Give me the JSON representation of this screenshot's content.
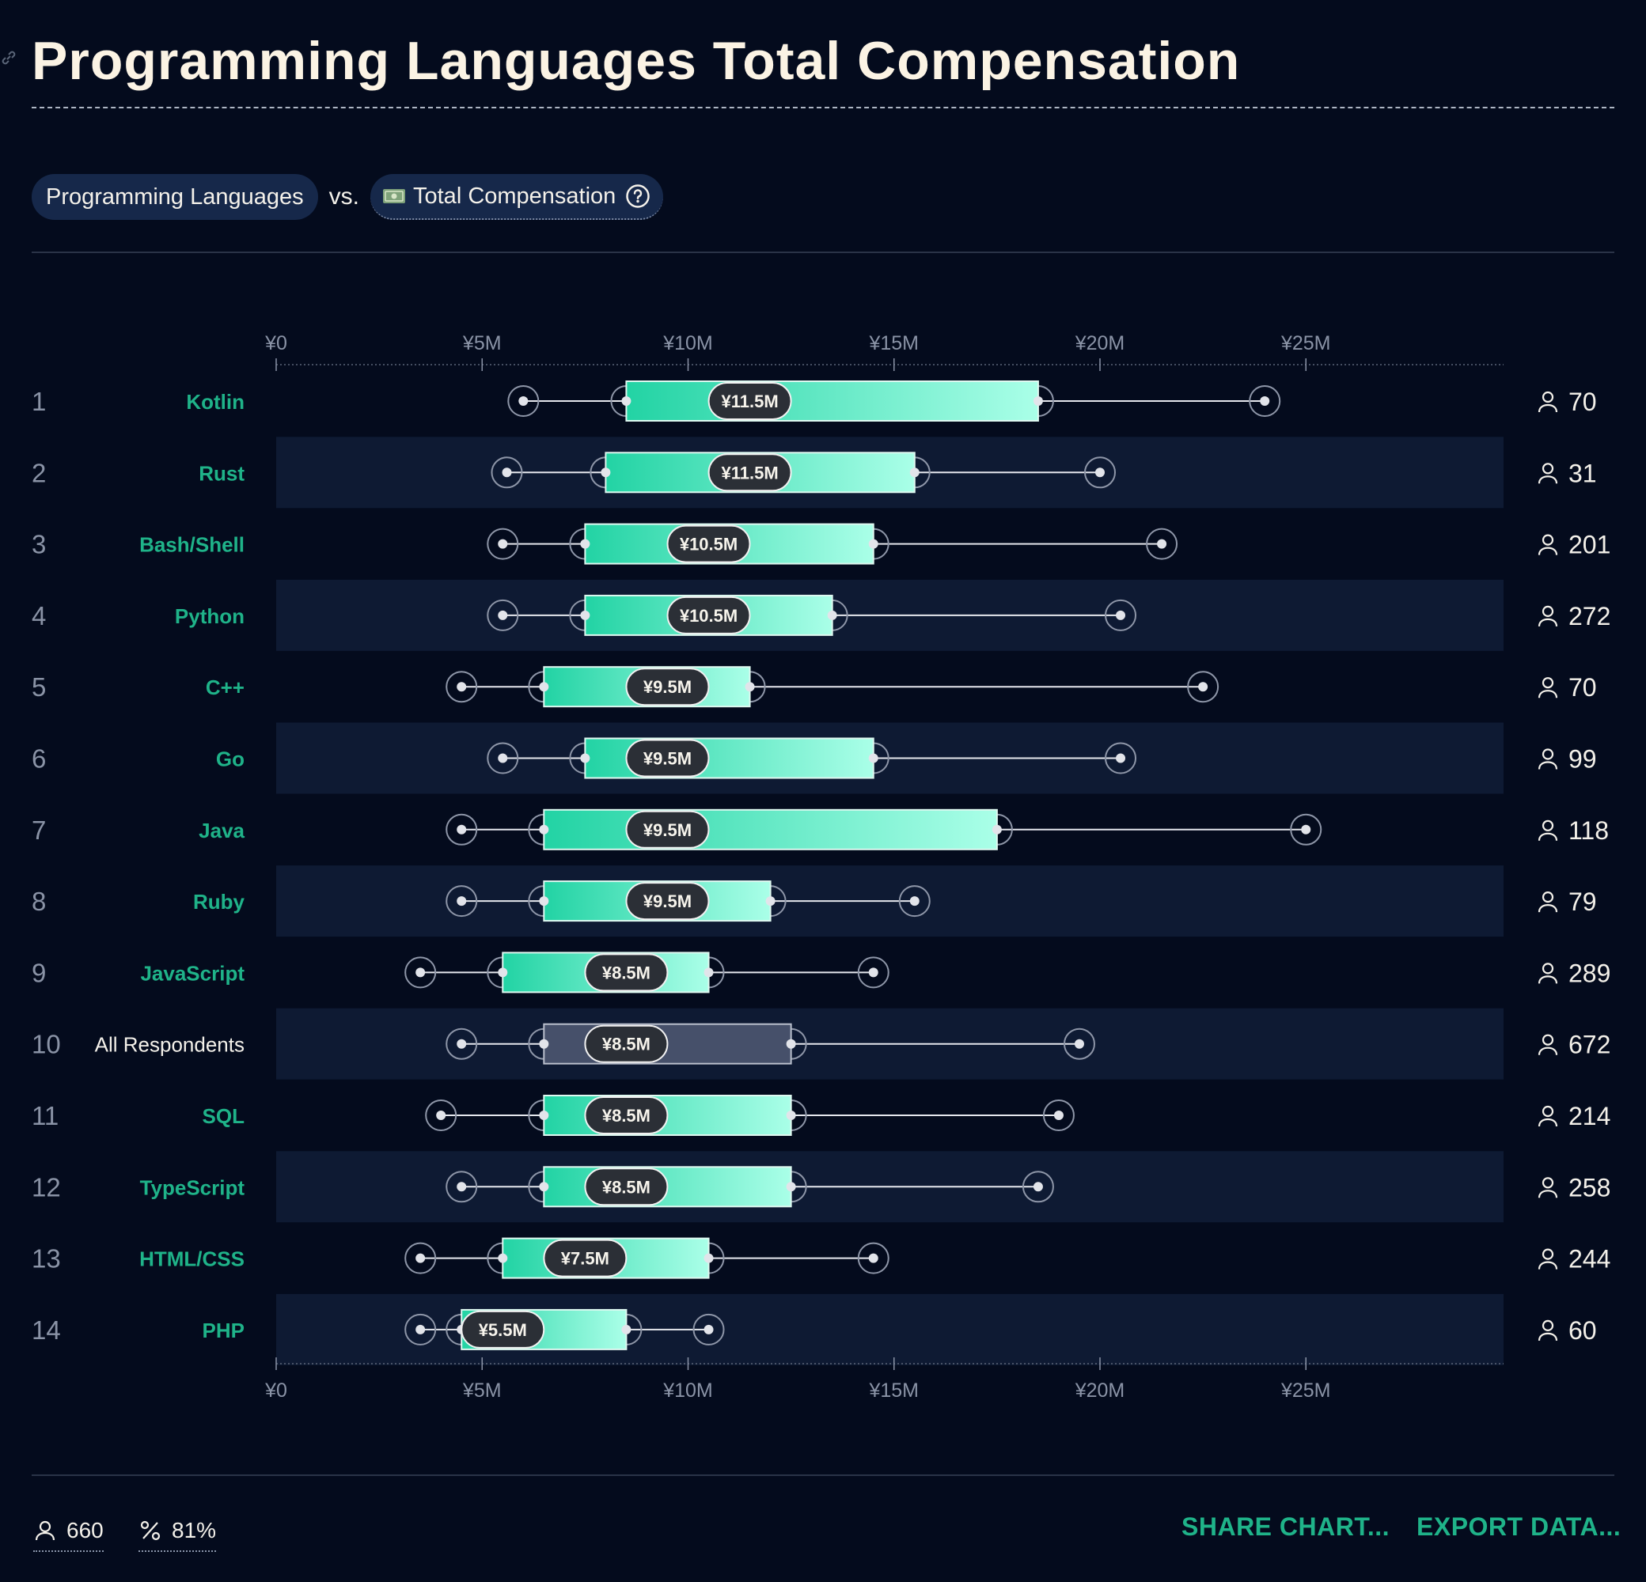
{
  "title": "Programming Languages Total Compensation",
  "filters": {
    "category": "Programming Languages",
    "vs": "vs.",
    "metric": "Total Compensation"
  },
  "footer": {
    "respondents": "660",
    "percentage": "81%",
    "share_label": "SHARE CHART...",
    "export_label": "EXPORT DATA..."
  },
  "colors": {
    "background": "#040b1d",
    "band": "#0e1a33",
    "accent": "#1fb389",
    "box_start": "#22d3a4",
    "box_end": "#aaffe8",
    "all_box": "#46506a",
    "median_pill": "#2b2f36"
  },
  "chart_data": {
    "type": "boxplot",
    "title": "Programming Languages Total Compensation",
    "xlabel": "",
    "ylabel": "",
    "xlim": [
      0,
      30000000
    ],
    "x_ticks": [
      0,
      5000000,
      10000000,
      15000000,
      20000000,
      25000000
    ],
    "x_tick_labels": [
      "¥0",
      "¥5M",
      "¥10M",
      "¥15M",
      "¥20M",
      "¥25M"
    ],
    "grid": false,
    "legend": "none",
    "series": [
      {
        "rank": "1",
        "name": "Kotlin",
        "whisker_low": 6000000,
        "q1": 8500000,
        "median": 11500000,
        "q3": 18500000,
        "whisker_high": 24000000,
        "median_label": "¥11.5M",
        "count": "70",
        "highlight": true
      },
      {
        "rank": "2",
        "name": "Rust",
        "whisker_low": 5600000,
        "q1": 8000000,
        "median": 11500000,
        "q3": 15500000,
        "whisker_high": 20000000,
        "median_label": "¥11.5M",
        "count": "31",
        "highlight": true
      },
      {
        "rank": "3",
        "name": "Bash/Shell",
        "whisker_low": 5500000,
        "q1": 7500000,
        "median": 10500000,
        "q3": 14500000,
        "whisker_high": 21500000,
        "median_label": "¥10.5M",
        "count": "201",
        "highlight": true
      },
      {
        "rank": "4",
        "name": "Python",
        "whisker_low": 5500000,
        "q1": 7500000,
        "median": 10500000,
        "q3": 13500000,
        "whisker_high": 20500000,
        "median_label": "¥10.5M",
        "count": "272",
        "highlight": true
      },
      {
        "rank": "5",
        "name": "C++",
        "whisker_low": 4500000,
        "q1": 6500000,
        "median": 9500000,
        "q3": 11500000,
        "whisker_high": 22500000,
        "median_label": "¥9.5M",
        "count": "70",
        "highlight": true
      },
      {
        "rank": "6",
        "name": "Go",
        "whisker_low": 5500000,
        "q1": 7500000,
        "median": 9500000,
        "q3": 14500000,
        "whisker_high": 20500000,
        "median_label": "¥9.5M",
        "count": "99",
        "highlight": true
      },
      {
        "rank": "7",
        "name": "Java",
        "whisker_low": 4500000,
        "q1": 6500000,
        "median": 9500000,
        "q3": 17500000,
        "whisker_high": 25000000,
        "median_label": "¥9.5M",
        "count": "118",
        "highlight": true
      },
      {
        "rank": "8",
        "name": "Ruby",
        "whisker_low": 4500000,
        "q1": 6500000,
        "median": 9500000,
        "q3": 12000000,
        "whisker_high": 15500000,
        "median_label": "¥9.5M",
        "count": "79",
        "highlight": true
      },
      {
        "rank": "9",
        "name": "JavaScript",
        "whisker_low": 3500000,
        "q1": 5500000,
        "median": 8500000,
        "q3": 10500000,
        "whisker_high": 14500000,
        "median_label": "¥8.5M",
        "count": "289",
        "highlight": true
      },
      {
        "rank": "10",
        "name": "All Respondents",
        "whisker_low": 4500000,
        "q1": 6500000,
        "median": 8500000,
        "q3": 12500000,
        "whisker_high": 19500000,
        "median_label": "¥8.5M",
        "count": "672",
        "highlight": false
      },
      {
        "rank": "11",
        "name": "SQL",
        "whisker_low": 4000000,
        "q1": 6500000,
        "median": 8500000,
        "q3": 12500000,
        "whisker_high": 19000000,
        "median_label": "¥8.5M",
        "count": "214",
        "highlight": true
      },
      {
        "rank": "12",
        "name": "TypeScript",
        "whisker_low": 4500000,
        "q1": 6500000,
        "median": 8500000,
        "q3": 12500000,
        "whisker_high": 18500000,
        "median_label": "¥8.5M",
        "count": "258",
        "highlight": true
      },
      {
        "rank": "13",
        "name": "HTML/CSS",
        "whisker_low": 3500000,
        "q1": 5500000,
        "median": 7500000,
        "q3": 10500000,
        "whisker_high": 14500000,
        "median_label": "¥7.5M",
        "count": "244",
        "highlight": true
      },
      {
        "rank": "14",
        "name": "PHP",
        "whisker_low": 3500000,
        "q1": 4500000,
        "median": 5500000,
        "q3": 8500000,
        "whisker_high": 10500000,
        "median_label": "¥5.5M",
        "count": "60",
        "highlight": true
      }
    ]
  }
}
